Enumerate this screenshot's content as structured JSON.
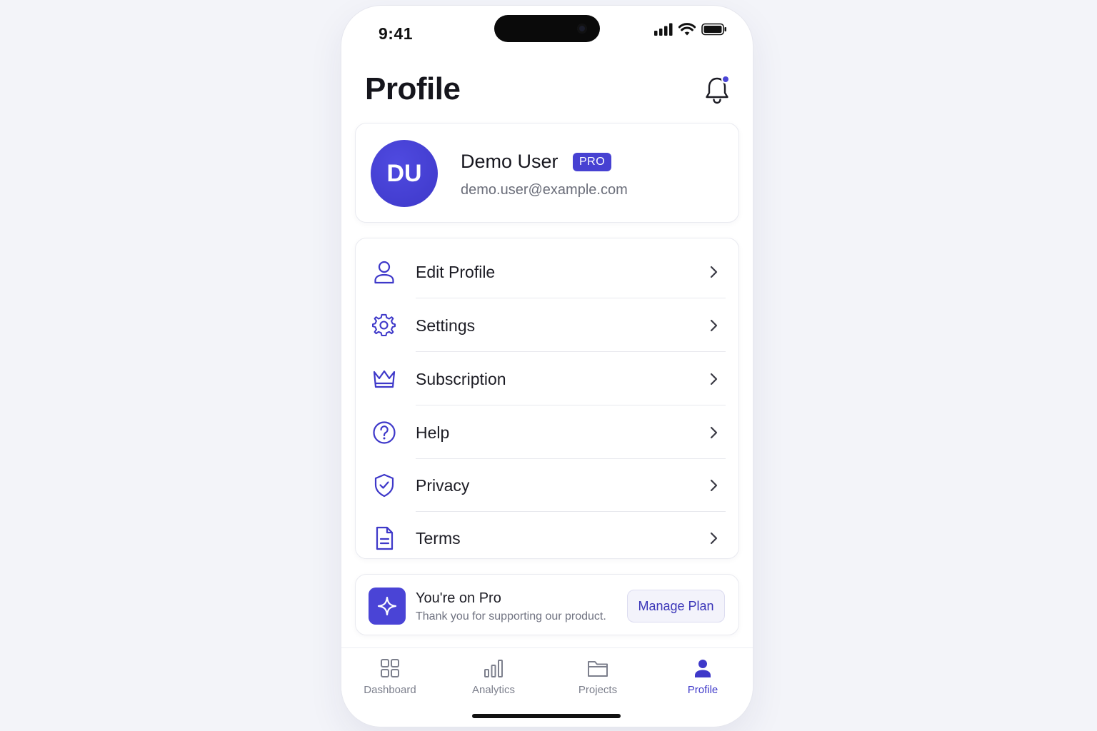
{
  "status_bar": {
    "time": "9:41"
  },
  "header": {
    "title": "Profile"
  },
  "profile": {
    "initials": "DU",
    "name": "Demo User",
    "badge": "PRO",
    "email": "demo.user@example.com"
  },
  "menu": {
    "items": [
      {
        "label": "Edit Profile",
        "icon": "user-icon"
      },
      {
        "label": "Settings",
        "icon": "gear-icon"
      },
      {
        "label": "Subscription",
        "icon": "crown-icon"
      },
      {
        "label": "Help",
        "icon": "question-circle-icon"
      },
      {
        "label": "Privacy",
        "icon": "shield-check-icon"
      },
      {
        "label": "Terms",
        "icon": "document-icon"
      }
    ]
  },
  "pro_banner": {
    "title": "You're on Pro",
    "subtitle": "Thank you for supporting our product.",
    "button": "Manage Plan"
  },
  "tabs": [
    {
      "label": "Dashboard",
      "icon": "grid-icon",
      "active": false
    },
    {
      "label": "Analytics",
      "icon": "bar-chart-icon",
      "active": false
    },
    {
      "label": "Projects",
      "icon": "folder-icon",
      "active": false
    },
    {
      "label": "Profile",
      "icon": "person-icon",
      "active": true
    }
  ],
  "colors": {
    "accent": "#4741d2",
    "background": "#f3f4f9",
    "text_muted": "#6b6e7a"
  }
}
